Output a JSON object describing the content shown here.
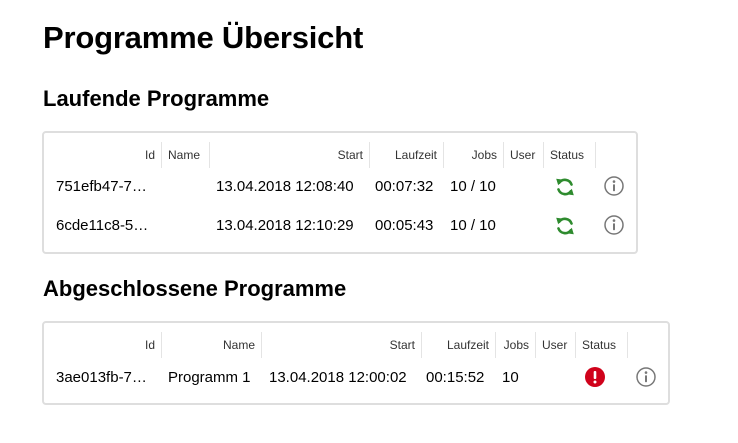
{
  "page_title": "Programme Übersicht",
  "running": {
    "title": "Laufende Programme",
    "columns": [
      "Id",
      "Name",
      "Start",
      "Laufzeit",
      "Jobs",
      "User",
      "Status"
    ],
    "rows": [
      {
        "id": "751efb47-7…",
        "name": "",
        "start": "13.04.2018 12:08:40",
        "runtime": "00:07:32",
        "jobs": "10 / 10",
        "user": "",
        "status_icon": "refresh-icon"
      },
      {
        "id": "6cde11c8-5…",
        "name": "",
        "start": "13.04.2018 12:10:29",
        "runtime": "00:05:43",
        "jobs": "10 / 10",
        "user": "",
        "status_icon": "refresh-icon"
      }
    ]
  },
  "finished": {
    "title": "Abgeschlossene Programme",
    "columns": [
      "Id",
      "Name",
      "Start",
      "Laufzeit",
      "Jobs",
      "User",
      "Status"
    ],
    "rows": [
      {
        "id": "3ae013fb-7…",
        "name": "Programm 1",
        "start": "13.04.2018 12:00:02",
        "runtime": "00:15:52",
        "jobs": "10",
        "user": "",
        "status_icon": "error-icon"
      }
    ]
  },
  "colors": {
    "running_icon": "#2e8b2e",
    "error_icon": "#d0021b",
    "info_icon": "#777777",
    "panel_border": "#dedede"
  }
}
